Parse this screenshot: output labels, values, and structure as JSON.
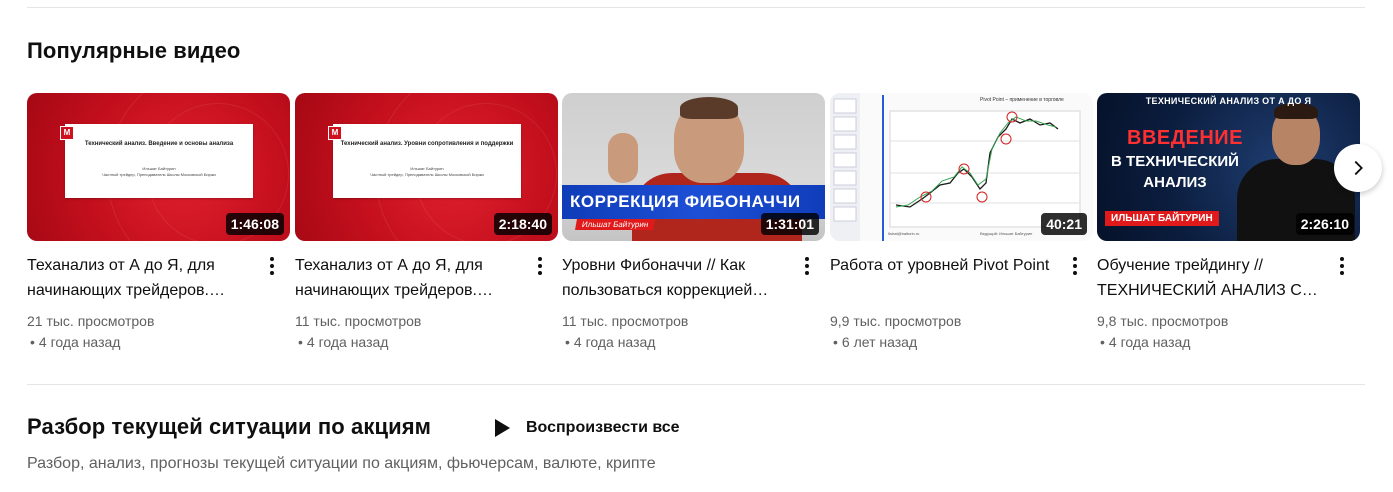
{
  "popular": {
    "title": "Популярные видео",
    "videos": [
      {
        "title": "Теханализ от А до Я, для начинающих трейдеров. Введение и основы анализа",
        "duration": "1:46:08",
        "views": "21 тыс. просмотров",
        "age": "4 года назад",
        "thumb": {
          "style": "red-slide",
          "logo": "М",
          "slide_title": "Технический анализ. Введение и основы анализа",
          "slide_author": "Ильшат Байтурин",
          "slide_role": "Частный трейдер, Преподаватель Школы Московской Биржи"
        }
      },
      {
        "title": "Теханализ от А до Я, для начинающих трейдеров. Уровни сопротивления и поддержки",
        "duration": "2:18:40",
        "views": "11 тыс. просмотров",
        "age": "4 года назад",
        "thumb": {
          "style": "red-slide",
          "logo": "М",
          "slide_title": "Технический анализ. Уровни сопротивления и поддержки",
          "slide_author": "Ильшат Байтурин",
          "slide_role": "Частный трейдер, Преподаватель Школы Московской Биржи"
        }
      },
      {
        "title": "Уровни Фибоначчи // Как пользоваться коррекцией Фибоначчи",
        "duration": "1:31:01",
        "views": "11 тыс. просмотров",
        "age": "4 года назад",
        "thumb": {
          "style": "person-banner",
          "banner": "КОРРЕКЦИЯ ФИБОНАЧЧИ",
          "tag": "Ильшат Байтурин"
        }
      },
      {
        "title": "Работа от уровней Pivot Point",
        "duration": "40:21",
        "views": "9,9 тыс. просмотров",
        "age": "6 лет назад",
        "thumb": {
          "style": "chart-screen",
          "header": "Pivot Point – применение в торговле",
          "footer_left": "Ilshat@baiturin.ru",
          "footer_right": "Ведущий: Ильшат Байтурин"
        }
      },
      {
        "title": "Обучение трейдингу // ТЕХНИЧЕСКИЙ АНАЛИЗ С НУЛЯ",
        "duration": "2:26:10",
        "views": "9,8 тыс. просмотров",
        "age": "4 года назад",
        "thumb": {
          "style": "dark-person",
          "top": "ТЕХНИЧЕСКИЙ АНАЛИЗ ОТ А ДО Я",
          "big1": "ВВЕДЕНИЕ",
          "big2": "В ТЕХНИЧЕСКИЙ АНАЛИЗ",
          "tag": "ИЛЬШАТ БАЙТУРИН"
        }
      }
    ],
    "next_icon": "chevron-right-icon"
  },
  "stocks": {
    "title": "Разбор текущей ситуации по акциям",
    "play_all": "Воспроизвести все",
    "play_icon": "play-icon",
    "description": "Разбор, анализ, прогнозы текущей ситуации по акциям, фьючерсам, валюте, крипте"
  },
  "age_separator": "•",
  "colors": {
    "text_primary": "#0f0f0f",
    "text_secondary": "#606060",
    "divider": "#e5e5e5",
    "accent_red": "#c40f1d",
    "accent_blue": "#1d4fd6"
  }
}
